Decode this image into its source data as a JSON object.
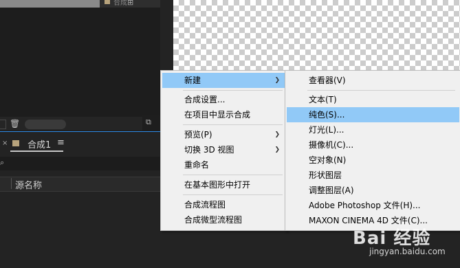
{
  "project_panel": {
    "footage_label": "合成",
    "footage_icon": "composition-icon"
  },
  "timeline": {
    "tab_close": "×",
    "tab_label": "合成1",
    "tab_menu": "≡",
    "column_source_name": "源名称",
    "search_icon": "search-icon",
    "trash_icon": "trash-icon"
  },
  "context_menu": {
    "items": [
      {
        "label": "新建",
        "has_submenu": true,
        "highlighted": true
      },
      {
        "label": "合成设置..."
      },
      {
        "label": "在项目中显示合成"
      },
      {
        "label": "预览(P)",
        "has_submenu": true
      },
      {
        "label": "切换 3D 视图",
        "has_submenu": true
      },
      {
        "label": "重命名"
      },
      {
        "label": "在基本图形中打开"
      },
      {
        "label": "合成流程图"
      },
      {
        "label": "合成微型流程图"
      }
    ]
  },
  "submenu": {
    "items": [
      {
        "label": "查看器(V)"
      },
      {
        "label": "文本(T)"
      },
      {
        "label": "纯色(S)...",
        "highlighted": true
      },
      {
        "label": "灯光(L)..."
      },
      {
        "label": "摄像机(C)..."
      },
      {
        "label": "空对象(N)"
      },
      {
        "label": "形状图层"
      },
      {
        "label": "调整图层(A)"
      },
      {
        "label": "Adobe Photoshop 文件(H)..."
      },
      {
        "label": "MAXON CINEMA 4D 文件(C)..."
      }
    ]
  },
  "watermark": {
    "brand": "Bai 经验",
    "url": "jingyan.baidu.com"
  },
  "colors": {
    "menu_highlight": "#91c9f7",
    "accent_blue": "#2d8ceb",
    "composition_swatch": "#b7a37c"
  }
}
